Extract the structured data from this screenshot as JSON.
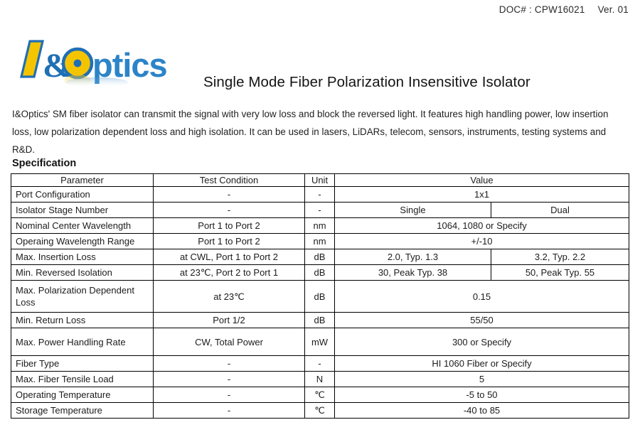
{
  "header": {
    "doc_label": "DOC# : CPW16021",
    "version": "Ver. 01"
  },
  "logo": {
    "text": "I&Optics",
    "yellow": "#F5C400",
    "blue": "#1F6FB5",
    "light_blue": "#3E8FD0"
  },
  "product_title": "Single Mode Fiber Polarization Insensitive Isolator",
  "intro": "I&Optics' SM fiber isolator can transmit the signal with very low loss and block the reversed light. It features high handling power, low insertion loss, low polarization dependent loss and high isolation. It can be used in lasers, LiDARs, telecom, sensors, instruments, testing systems and R&D.",
  "spec_heading": "Specification",
  "table": {
    "columns": [
      "Parameter",
      "Test Condition",
      "Unit",
      "Value"
    ],
    "rows": [
      {
        "parameter": "Port Configuration",
        "condition": "-",
        "unit": "-",
        "value": "1x1",
        "span": true
      },
      {
        "parameter": "Isolator Stage Number",
        "condition": "-",
        "unit": "-",
        "value_single": "Single",
        "value_dual": "Dual",
        "span": false
      },
      {
        "parameter": "Nominal Center Wavelength",
        "condition": "Port 1 to Port 2",
        "unit": "nm",
        "value": "1064, 1080 or Specify",
        "span": true
      },
      {
        "parameter": "Operaing Wavelength Range",
        "condition": "Port 1 to Port 2",
        "unit": "nm",
        "value": "+/-10",
        "span": true
      },
      {
        "parameter": "Max. Insertion Loss",
        "condition": "at CWL, Port 1 to Port 2",
        "unit": "dB",
        "value_single": "2.0, Typ. 1.3",
        "value_dual": "3.2, Typ. 2.2",
        "span": false
      },
      {
        "parameter": "Min. Reversed Isolation",
        "condition": "at 23℃, Port 2 to Port 1",
        "unit": "dB",
        "value_single": "30, Peak Typ. 38",
        "value_dual": "50, Peak Typ. 55",
        "span": false
      },
      {
        "parameter": "Max. Polarization Dependent Loss",
        "condition": "at 23℃",
        "unit": "dB",
        "value": "0.15",
        "span": true
      },
      {
        "parameter": "Min. Return Loss",
        "condition": "Port 1/2",
        "unit": "dB",
        "value": "55/50",
        "span": true
      },
      {
        "parameter": "Max. Power Handling Rate",
        "condition": "CW, Total Power",
        "unit": "mW",
        "value": "300 or Specify",
        "span": true
      },
      {
        "parameter": "Fiber Type",
        "condition": "-",
        "unit": "-",
        "value": "HI 1060 Fiber or Specify",
        "span": true
      },
      {
        "parameter": "Max. Fiber Tensile Load",
        "condition": "-",
        "unit": "N",
        "value": "5",
        "span": true
      },
      {
        "parameter": "Operating Temperature",
        "condition": "-",
        "unit": "℃",
        "value": "-5 to 50",
        "span": true
      },
      {
        "parameter": "Storage Temperature",
        "condition": "-",
        "unit": "℃",
        "value": "-40 to 85",
        "span": true
      }
    ]
  }
}
